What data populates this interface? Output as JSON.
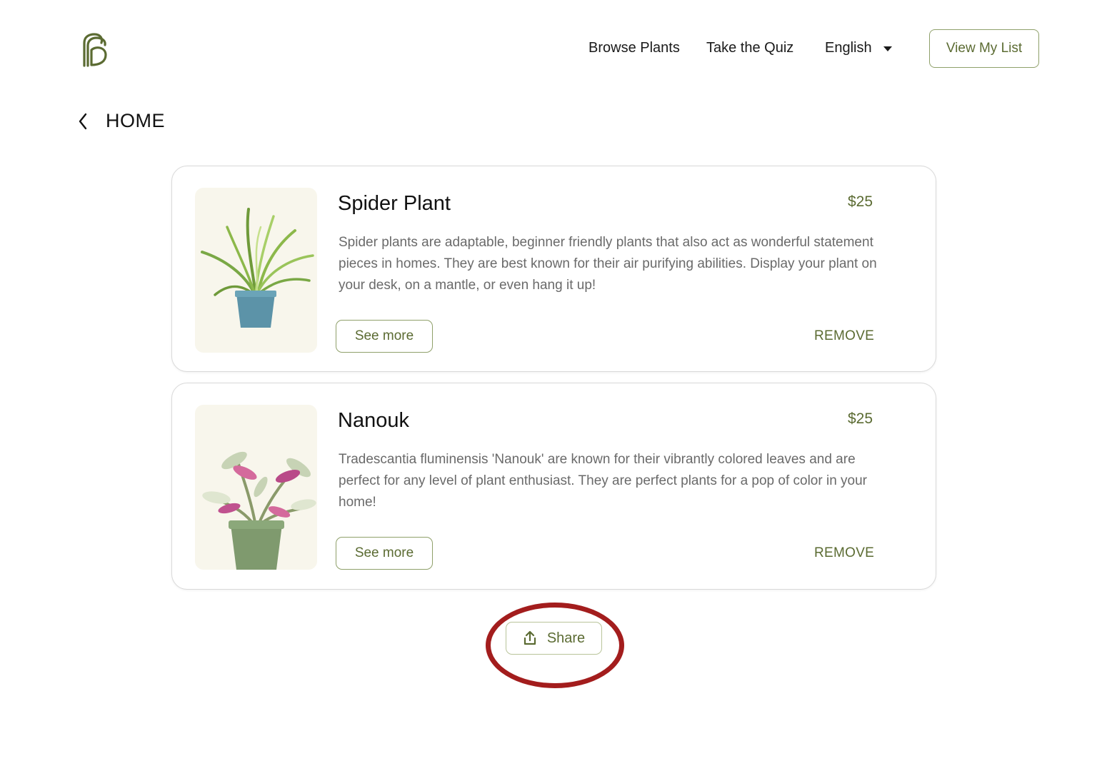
{
  "header": {
    "nav": {
      "browse_plants": "Browse Plants",
      "take_quiz": "Take the Quiz",
      "language": "English"
    },
    "view_list_label": "View My List"
  },
  "breadcrumb": {
    "title": "HOME"
  },
  "items": [
    {
      "name": "Spider Plant",
      "price": "$25",
      "description": "Spider plants are adaptable, beginner friendly plants that also act as wonderful statement pieces in homes. They are best known for their air purifying abilities. Display your plant on your desk, on a mantle, or even hang it up!",
      "see_more_label": "See more",
      "remove_label": "REMOVE"
    },
    {
      "name": "Nanouk",
      "price": "$25",
      "description": "Tradescantia fluminensis 'Nanouk' are known for their vibrantly colored leaves and are perfect for any level of plant enthusiast. They are perfect plants for a pop of color in your home!",
      "see_more_label": "See more",
      "remove_label": "REMOVE"
    }
  ],
  "share_label": "Share",
  "colors": {
    "accent": "#5b6b32",
    "border_accent": "#8fa06a",
    "highlight_circle": "#a31d1d",
    "image_bg": "#f8f6ec"
  }
}
